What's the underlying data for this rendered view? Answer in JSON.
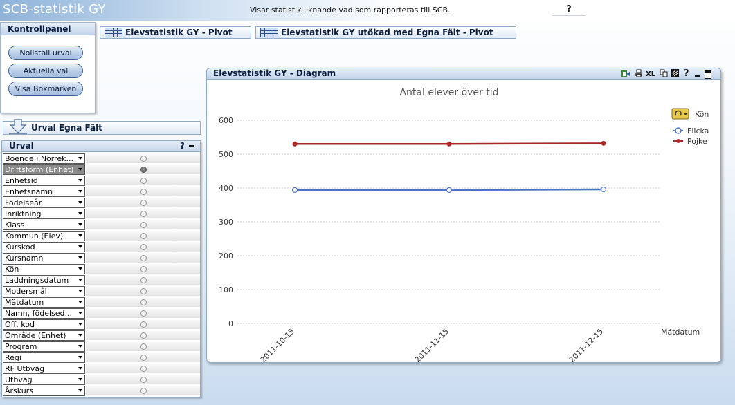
{
  "app": {
    "title": "SCB-statistik GY",
    "subtitle": "Visar statistik liknande vad som rapporteras till SCB.",
    "help": "?"
  },
  "kontrollpanel": {
    "title": "Kontrollpanel",
    "buttons": [
      "Nollställ urval",
      "Aktuella val",
      "Visa Bokmärken"
    ]
  },
  "pivots": [
    {
      "label": "Elevstatistik GY - Pivot"
    },
    {
      "label": "Elevstatistik GY utökad med Egna Fält - Pivot"
    }
  ],
  "urval_egna": {
    "label": "Urval Egna Fält"
  },
  "urval": {
    "title": "Urval",
    "help": "?",
    "fields": [
      {
        "label": "Boende i Norrek...",
        "selected": false
      },
      {
        "label": "Driftsform (Enhet)",
        "selected": true
      },
      {
        "label": "Enhetsid",
        "selected": false
      },
      {
        "label": "Enhetsnamn",
        "selected": false
      },
      {
        "label": "Födelseår",
        "selected": false
      },
      {
        "label": "Inriktning",
        "selected": false
      },
      {
        "label": "Klass",
        "selected": false
      },
      {
        "label": "Kommun (Elev)",
        "selected": false
      },
      {
        "label": "Kurskod",
        "selected": false
      },
      {
        "label": "Kursnamn",
        "selected": false
      },
      {
        "label": "Kön",
        "selected": false
      },
      {
        "label": "Laddningsdatum",
        "selected": false
      },
      {
        "label": "Modersmål",
        "selected": false
      },
      {
        "label": "Mätdatum",
        "selected": false
      },
      {
        "label": "Namn, födelsed...",
        "selected": false
      },
      {
        "label": "Off. kod",
        "selected": false
      },
      {
        "label": "Område (Enhet)",
        "selected": false
      },
      {
        "label": "Program",
        "selected": false
      },
      {
        "label": "Regi",
        "selected": false
      },
      {
        "label": "RF Utbväg",
        "selected": false
      },
      {
        "label": "Utbväg",
        "selected": false
      },
      {
        "label": "Årskurs",
        "selected": false
      }
    ]
  },
  "chart_window": {
    "title": "Elevstatistik GY - Diagram",
    "icons": [
      "excel-send-icon",
      "print-icon",
      "xl-export-icon",
      "copy-icon",
      "info-icon",
      "help-icon",
      "minimize-icon",
      "maximize-icon"
    ],
    "icon_text": {
      "xl": "XL",
      "help": "?"
    }
  },
  "chart_data": {
    "type": "line",
    "title": "Antal elever över tid",
    "xlabel": "Mätdatum",
    "ylabel": "",
    "categories": [
      "2011-10-15",
      "2011-11-15",
      "2011-12-15"
    ],
    "yticks": [
      0,
      100,
      200,
      300,
      400,
      500,
      600
    ],
    "ylim": [
      0,
      600
    ],
    "grid": true,
    "legend": {
      "title": "Kön",
      "position": "top-right"
    },
    "series": [
      {
        "name": "Flicka",
        "values": [
          394,
          394,
          396
        ],
        "color": "#4a74c4",
        "marker": "open-circle"
      },
      {
        "name": "Pojke",
        "values": [
          530,
          530,
          532
        ],
        "color": "#a82828",
        "marker": "filled-circle"
      }
    ]
  }
}
